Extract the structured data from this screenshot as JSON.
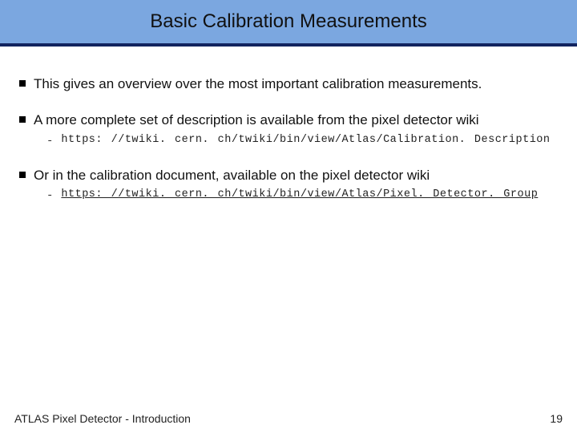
{
  "title": "Basic Calibration Measurements",
  "bullets": [
    {
      "text": "This gives an overview over the most important calibration measurements.",
      "sub": []
    },
    {
      "text": "A more complete set of description is available from the pixel detector wiki",
      "sub": [
        {
          "text": "https: //twiki. cern. ch/twiki/bin/view/Atlas/Calibration. Description",
          "link": false
        }
      ]
    },
    {
      "text": "Or in the calibration document, available on the pixel detector wiki",
      "sub": [
        {
          "text": "https: //twiki. cern. ch/twiki/bin/view/Atlas/Pixel. Detector. Group",
          "link": true
        }
      ]
    }
  ],
  "footer": {
    "left": "ATLAS Pixel Detector - Introduction",
    "page": "19"
  }
}
